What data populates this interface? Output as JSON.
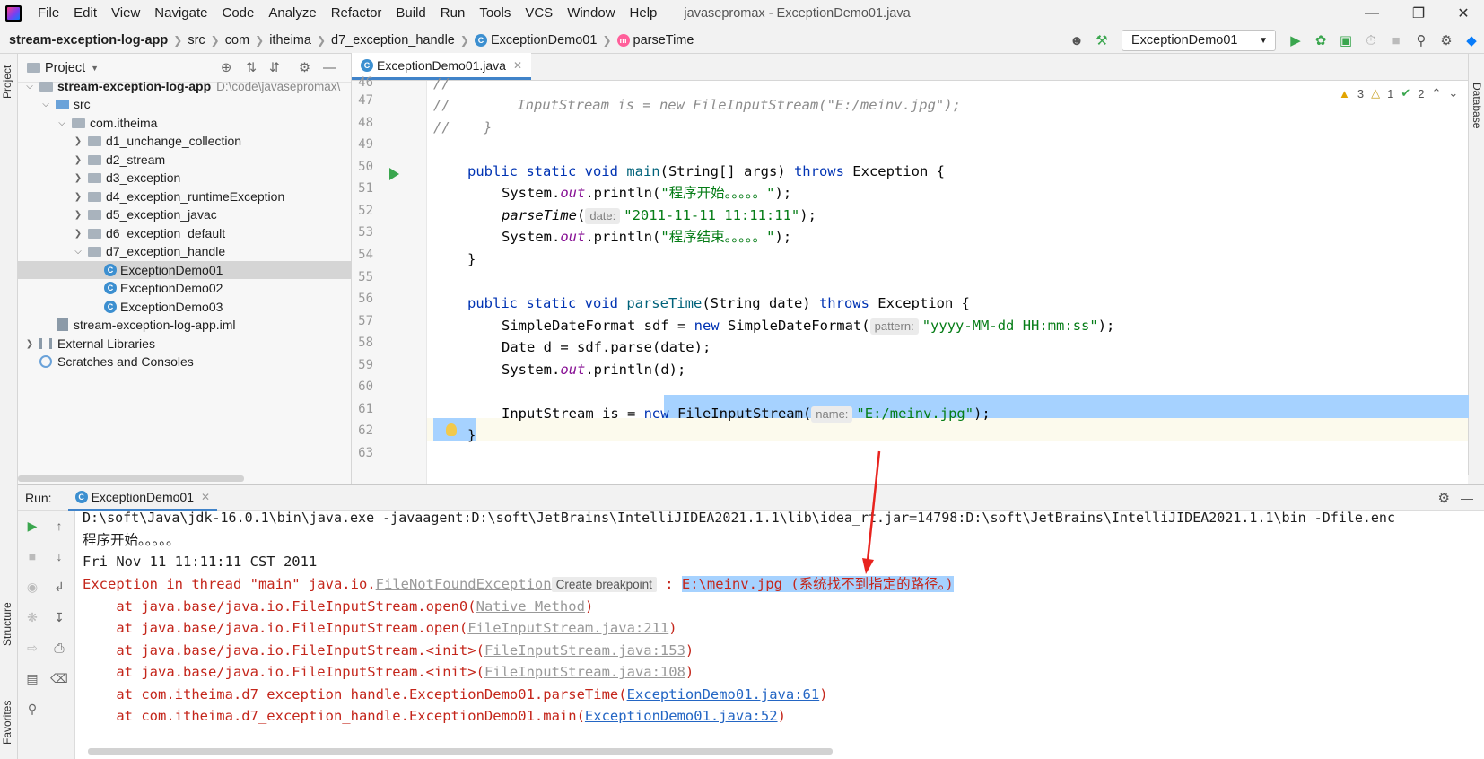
{
  "menu": {
    "items": [
      "File",
      "Edit",
      "View",
      "Navigate",
      "Code",
      "Analyze",
      "Refactor",
      "Build",
      "Run",
      "Tools",
      "VCS",
      "Window",
      "Help"
    ],
    "window_title": "javasepromax - ExceptionDemo01.java"
  },
  "breadcrumb": {
    "items": [
      "stream-exception-log-app",
      "src",
      "com",
      "itheima",
      "d7_exception_handle",
      "ExceptionDemo01",
      "parseTime"
    ]
  },
  "run_config": {
    "label": "ExceptionDemo01"
  },
  "project_panel": {
    "title": "Project",
    "module_name": "stream-exception-log-app",
    "module_path": "D:\\code\\javasepromax\\",
    "tree": [
      {
        "label": "src",
        "level": 1
      },
      {
        "label": "com.itheima",
        "level": 2
      },
      {
        "label": "d1_unchange_collection",
        "level": 3
      },
      {
        "label": "d2_stream",
        "level": 3
      },
      {
        "label": "d3_exception",
        "level": 3
      },
      {
        "label": "d4_exception_runtimeException",
        "level": 3
      },
      {
        "label": "d5_exception_javac",
        "level": 3
      },
      {
        "label": "d6_exception_default",
        "level": 3
      },
      {
        "label": "d7_exception_handle",
        "level": 3
      },
      {
        "label": "ExceptionDemo01",
        "level": 4
      },
      {
        "label": "ExceptionDemo02",
        "level": 4
      },
      {
        "label": "ExceptionDemo03",
        "level": 4
      },
      {
        "label": "stream-exception-log-app.iml",
        "level": 2
      },
      {
        "label": "External Libraries",
        "level": 0
      },
      {
        "label": "Scratches and Consoles",
        "level": 0
      }
    ]
  },
  "editor": {
    "tab_label": "ExceptionDemo01.java",
    "inspections": {
      "warnings": "3",
      "weak_warnings": "1",
      "typos": "2"
    },
    "line_numbers": [
      "46",
      "47",
      "48",
      "49",
      "50",
      "51",
      "52",
      "53",
      "54",
      "55",
      "56",
      "57",
      "58",
      "59",
      "60",
      "61",
      "62",
      "63"
    ],
    "code": {
      "l46": "//",
      "l47": "//        InputStream is = new FileInputStream(\"E:/meinv.jpg\");",
      "l48": "//    }",
      "l50_kw": "public static void ",
      "l50_fn": "main",
      "l50_rest": "(String[] args) ",
      "l50_throws": "throws",
      "l50_end": " Exception {",
      "l51_a": "System.",
      "l51_out": "out",
      "l51_b": ".println(",
      "l51_str": "\"程序开始。。。。。\"",
      "l51_c": ");",
      "l52_fn": "parseTime",
      "l52_a": "(",
      "l52_hint": "date:",
      "l52_str": "\"2011-11-11 11:11:11\"",
      "l52_b": ");",
      "l53_a": "System.",
      "l53_out": "out",
      "l53_b": ".println(",
      "l53_str": "\"程序结束。。。。。\"",
      "l53_c": ");",
      "l54": "}",
      "l56_kw": "public static void ",
      "l56_fn": "parseTime",
      "l56_rest": "(String date) ",
      "l56_throws": "throws",
      "l56_end": " Exception {",
      "l57_a": "SimpleDateFormat sdf = ",
      "l57_new": "new",
      "l57_b": " SimpleDateFormat(",
      "l57_hint": "pattern:",
      "l57_str": "\"yyyy-MM-dd HH:mm:ss\"",
      "l57_c": ");",
      "l58": "Date d = sdf.parse(date);",
      "l59_a": "System.",
      "l59_out": "out",
      "l59_b": ".println(d);",
      "l61_a": "InputStream is = ",
      "l61_new": "new",
      "l61_b": " FileInputStream(",
      "l61_hint": "name:",
      "l61_str": "\"E:/meinv.jpg\"",
      "l61_c": ");",
      "l62": "}"
    }
  },
  "run_panel": {
    "label": "Run:",
    "tab": "ExceptionDemo01",
    "console": {
      "cmd": "D:\\soft\\Java\\jdk-16.0.1\\bin\\java.exe -javaagent:D:\\soft\\JetBrains\\IntelliJIDEA2021.1.1\\lib\\idea_rt.jar=14798:D:\\soft\\JetBrains\\IntelliJIDEA2021.1.1\\bin -Dfile.enc",
      "start": "程序开始。。。。。",
      "date": "Fri Nov 11 11:11:11 CST 2011",
      "exc_prefix": "Exception in thread \"main\" java.io.",
      "exc_class": "FileNotFoundException",
      "exc_hint": "Create breakpoint",
      "exc_sep": " : ",
      "exc_msg": "E:\\meinv.jpg (系统找不到指定的路径。)",
      "frames": [
        {
          "prefix": "    at java.base/java.io.FileInputStream.open0(",
          "link": "Native Method",
          "suffix": ")",
          "style": "grey"
        },
        {
          "prefix": "    at java.base/java.io.FileInputStream.open(",
          "link": "FileInputStream.java:211",
          "suffix": ")",
          "style": "grey"
        },
        {
          "prefix": "    at java.base/java.io.FileInputStream.<init>(",
          "link": "FileInputStream.java:153",
          "suffix": ")",
          "style": "grey"
        },
        {
          "prefix": "    at java.base/java.io.FileInputStream.<init>(",
          "link": "FileInputStream.java:108",
          "suffix": ")",
          "style": "grey"
        },
        {
          "prefix": "    at com.itheima.d7_exception_handle.ExceptionDemo01.parseTime(",
          "link": "ExceptionDemo01.java:61",
          "suffix": ")",
          "style": "blue"
        },
        {
          "prefix": "    at com.itheima.d7_exception_handle.ExceptionDemo01.main(",
          "link": "ExceptionDemo01.java:52",
          "suffix": ")",
          "style": "blue"
        }
      ]
    }
  },
  "side_labels": {
    "project": "Project",
    "structure": "Structure",
    "favorites": "Favorites",
    "database": "Database"
  },
  "colors": {
    "accent": "#4083c9",
    "selection": "#a6d2ff",
    "error": "#c4261b",
    "annotation_arrow": "#e8231e"
  }
}
